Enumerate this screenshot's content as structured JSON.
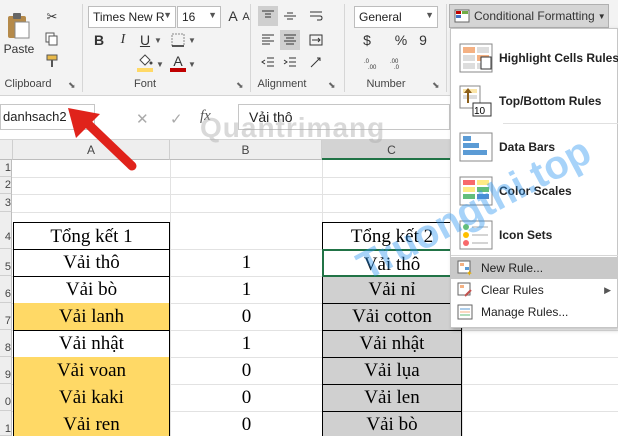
{
  "ribbon": {
    "paste_label": "Paste",
    "clipboard_label": "Clipboard",
    "font_label": "Font",
    "alignment_label": "Alignment",
    "number_label": "Number",
    "font_name": "Times New R",
    "font_size": "16",
    "number_format": "General",
    "bold": "B",
    "italic": "I",
    "underline": "U",
    "currency": "$",
    "percent": "%",
    "comma": "9",
    "font_color_glyph": "A",
    "inc_font": "A",
    "dec_font": "A",
    "cond_format_label": "Conditional Formatting",
    "colors": {
      "fill": "#ffd966",
      "font": "#c00000",
      "header_green": "#217346"
    }
  },
  "formula_bar": {
    "name_box": "danhsach2",
    "fx": "fx",
    "value": "Vải thô"
  },
  "sheet": {
    "columns": [
      "A",
      "B",
      "C"
    ],
    "rows": [
      "1",
      "2",
      "3",
      "4",
      "5",
      "6",
      "7",
      "8",
      "9",
      "0",
      "1"
    ],
    "col_a": [
      "Tổng kết 1",
      "Vải thô",
      "Vải bò",
      "Vải lanh",
      "Vải nhật",
      "Vải voan",
      "Vải kaki",
      "Vải ren"
    ],
    "col_b": [
      "1",
      "1",
      "0",
      "1",
      "0",
      "0",
      "0"
    ],
    "col_c": [
      "Tổng kết 2",
      "Vải thô",
      "Vải nỉ",
      "Vải cotton",
      "Vải nhật",
      "Vải lụa",
      "Vải len",
      "Vải bò"
    ],
    "highlight_color": "#ffd966",
    "selection_color": "#d0d0d0"
  },
  "menu": {
    "items": [
      {
        "label": "Highlight Cells Rules",
        "icon": "highlight-cells-icon"
      },
      {
        "label": "Top/Bottom Rules",
        "icon": "top-bottom-icon"
      },
      {
        "label": "Data Bars",
        "icon": "data-bars-icon"
      },
      {
        "label": "Color Scales",
        "icon": "color-scales-icon"
      },
      {
        "label": "Icon Sets",
        "icon": "icon-sets-icon"
      }
    ],
    "small_items": [
      {
        "label": "New Rule...",
        "icon": "new-rule-icon"
      },
      {
        "label": "Clear Rules",
        "icon": "clear-rules-icon"
      },
      {
        "label": "Manage Rules...",
        "icon": "manage-rules-icon"
      }
    ],
    "top_bottom_icon_text": "10"
  },
  "watermark": {
    "text_1": "Quantrimang",
    "text_2": "Truongthi.top"
  }
}
